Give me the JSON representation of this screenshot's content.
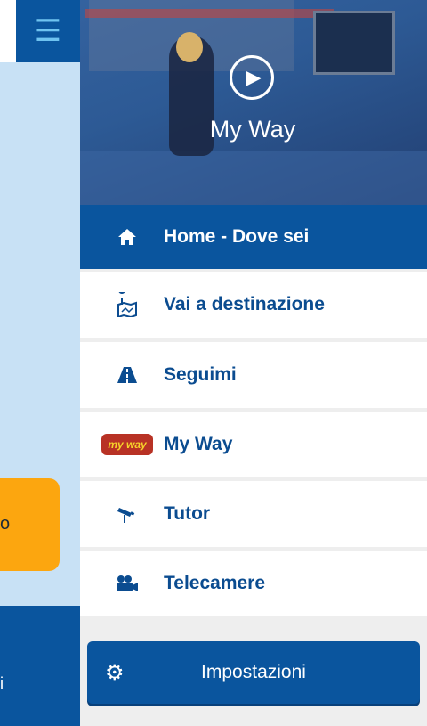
{
  "background": {
    "menu_icon": "hamburger-icon",
    "orange_card_text": "o",
    "bottom_text": "i"
  },
  "drawer": {
    "hero": {
      "caption": "My Way",
      "play_icon": "play-icon"
    },
    "items": [
      {
        "label": "Home - Dove sei",
        "icon": "home-icon",
        "active": true
      },
      {
        "label": "Vai a destinazione",
        "icon": "map-destination-icon"
      },
      {
        "label": "Seguimi",
        "icon": "road-icon"
      },
      {
        "label": "My Way",
        "icon": "myway-badge",
        "badge_text": "my way"
      },
      {
        "label": "Tutor",
        "icon": "camera-icon"
      },
      {
        "label": "Telecamere",
        "icon": "video-camera-icon"
      }
    ],
    "settings": {
      "label": "Impostazioni",
      "icon": "gear-icon"
    }
  },
  "colors": {
    "primary": "#0a559e",
    "light_blue": "#c8e1f5",
    "orange": "#fca60f",
    "badge_red": "#b83225",
    "badge_yellow": "#f6d22a"
  }
}
